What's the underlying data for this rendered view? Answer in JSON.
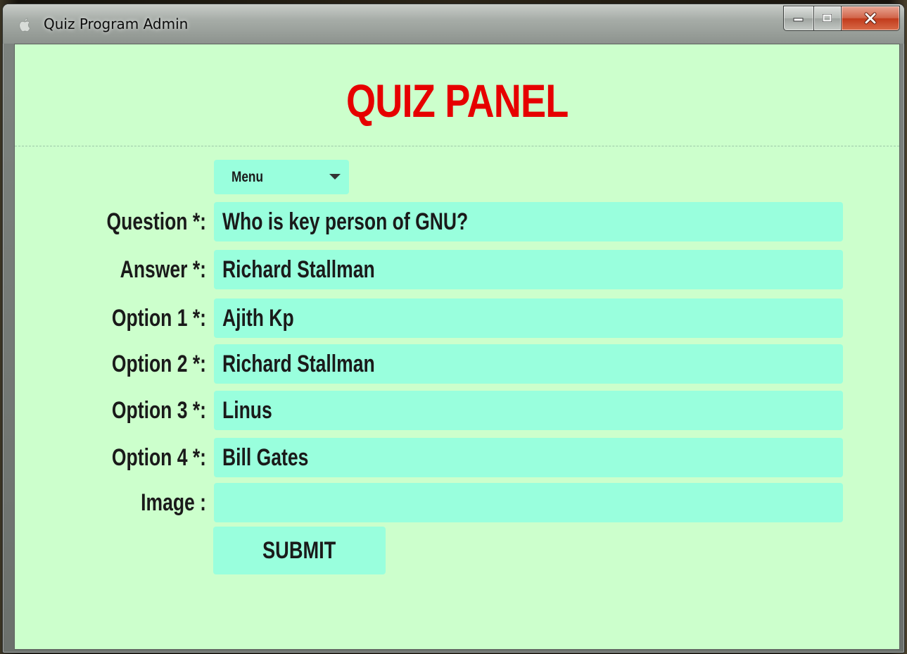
{
  "window": {
    "title": "Quiz Program Admin",
    "app_icon": "apple-icon",
    "controls": {
      "minimize_icon": "minimize-icon",
      "maximize_icon": "maximize-icon",
      "close_icon": "close-icon"
    }
  },
  "panel": {
    "title": "QUIZ PANEL",
    "title_color": "#e60000",
    "background_color": "#ccffcc",
    "field_color": "#99ffdd"
  },
  "menu": {
    "selected": "Menu"
  },
  "form": {
    "question": {
      "label": "Question *:",
      "value": "Who is key person of GNU?"
    },
    "answer": {
      "label": "Answer *:",
      "value": "Richard Stallman"
    },
    "option1": {
      "label": "Option 1 *:",
      "value": "Ajith Kp"
    },
    "option2": {
      "label": "Option 2 *:",
      "value": "Richard Stallman"
    },
    "option3": {
      "label": "Option 3 *:",
      "value": "Linus"
    },
    "option4": {
      "label": "Option 4 *:",
      "value": "Bill Gates"
    },
    "image": {
      "label": "Image :",
      "value": ""
    },
    "submit_label": "SUBMIT"
  }
}
